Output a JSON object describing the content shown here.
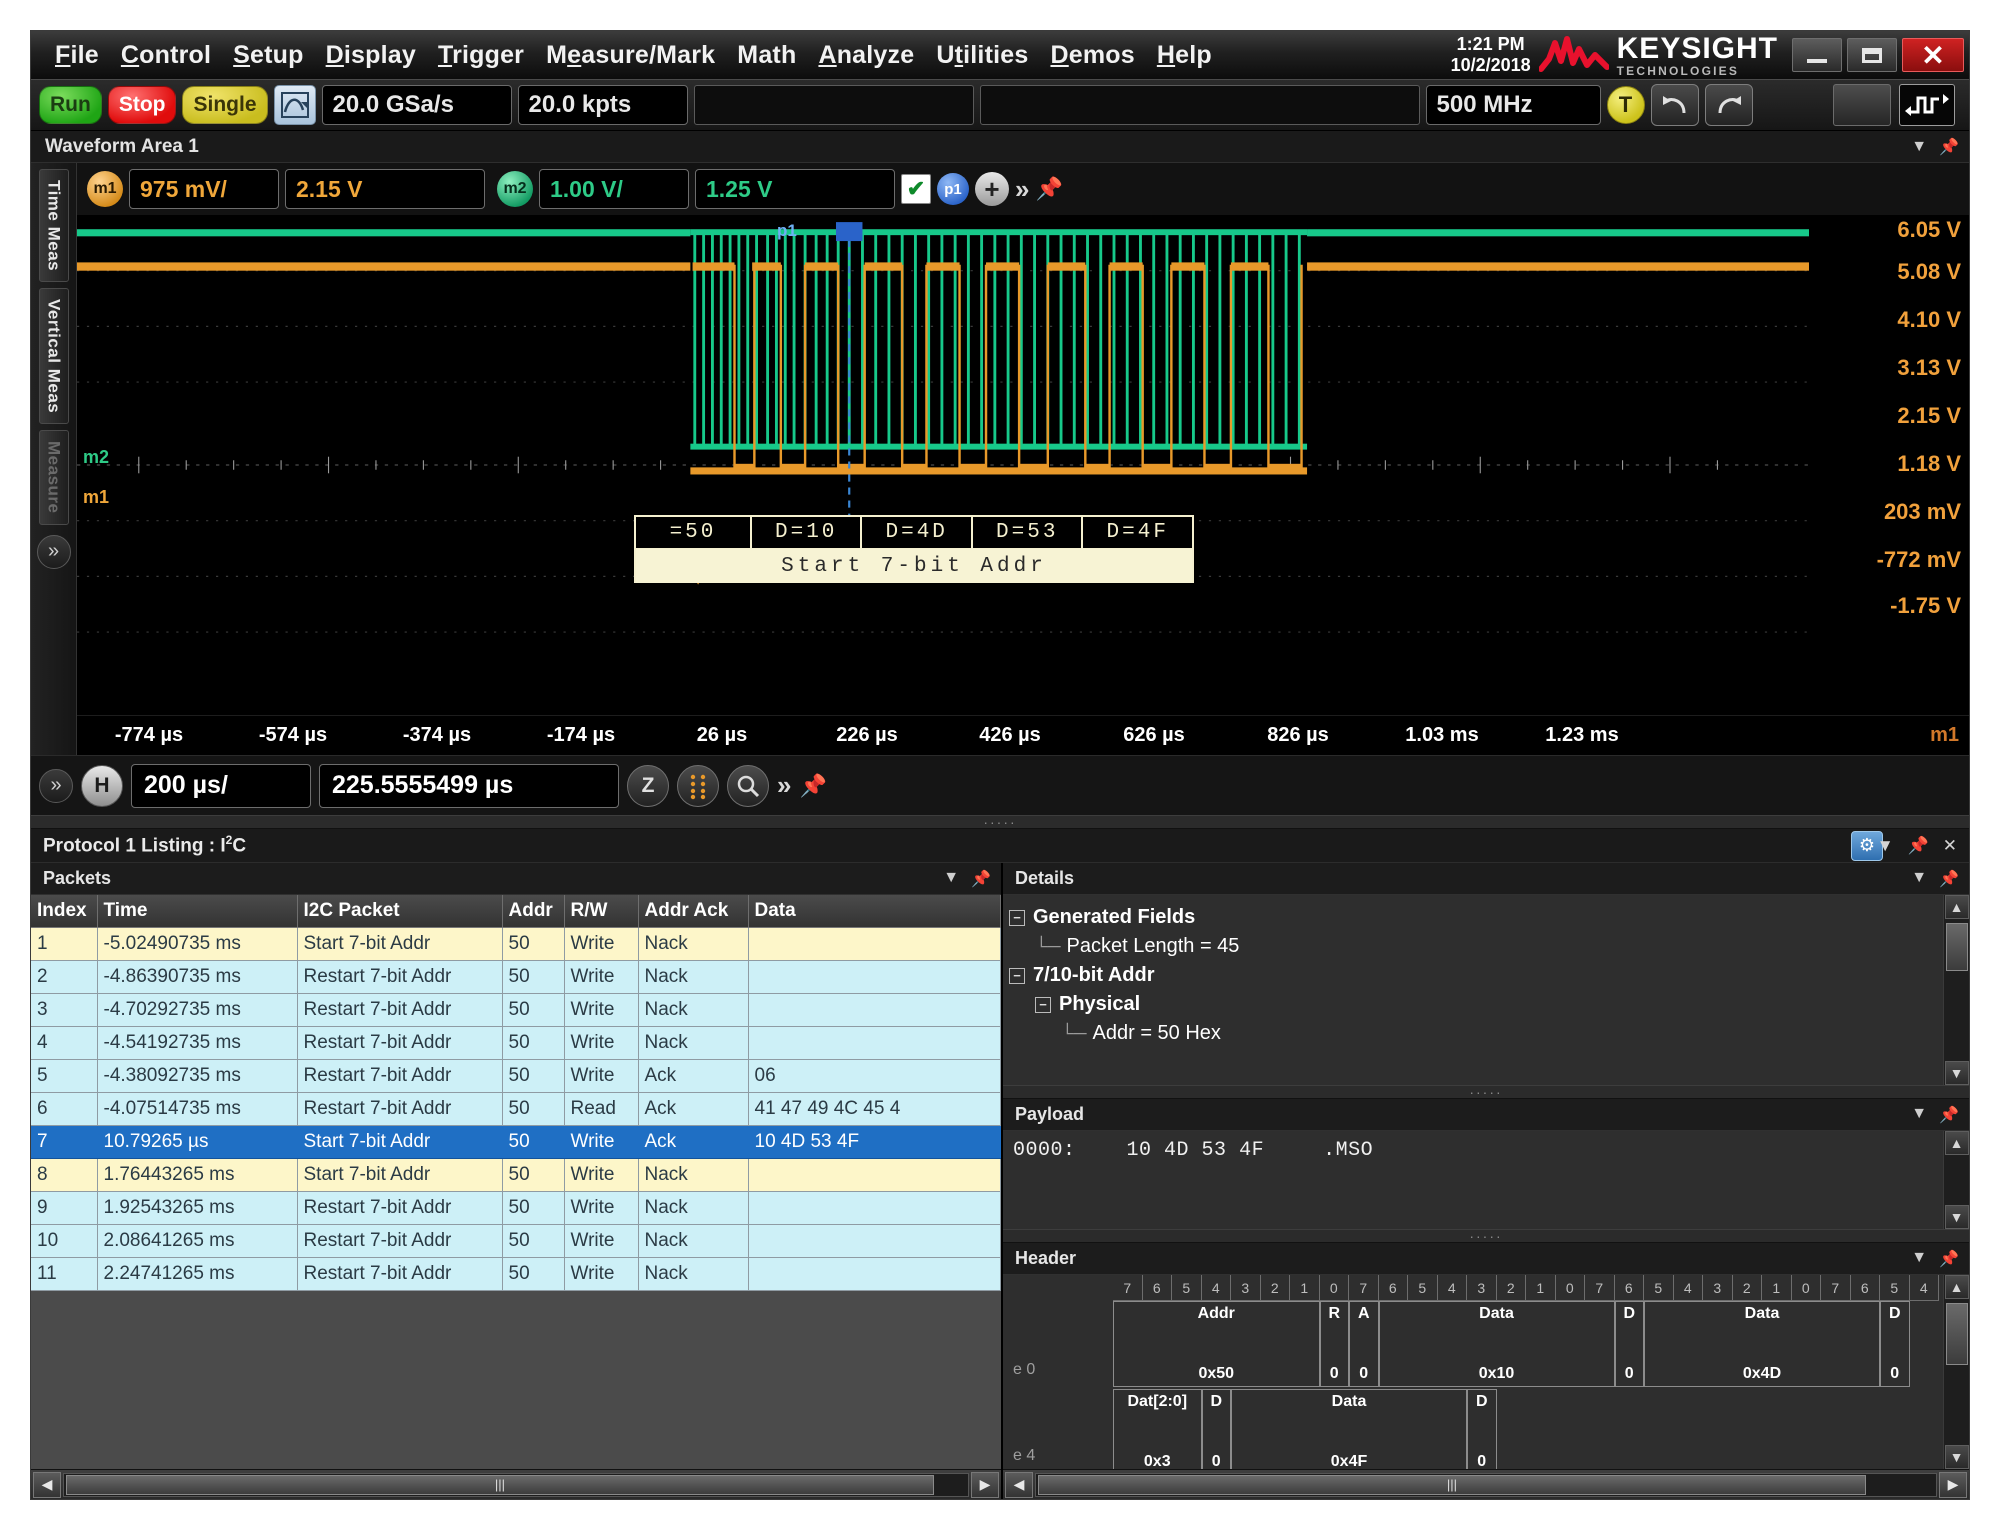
{
  "titlebar": {
    "menu": [
      "File",
      "Control",
      "Setup",
      "Display",
      "Trigger",
      "Measure/Mark",
      "Math",
      "Analyze",
      "Utilities",
      "Demos",
      "Help"
    ],
    "time": "1:21 PM",
    "date": "10/2/2018",
    "brand": "KEYSIGHT",
    "brand_sub": "TECHNOLOGIES",
    "minimize": "–",
    "maximize": "□",
    "close": "✕"
  },
  "toolbar": {
    "run": "Run",
    "stop": "Stop",
    "single": "Single",
    "sample_rate": "20.0 GSa/s",
    "memory": "20.0 kpts",
    "bandwidth": "500 MHz",
    "trigger_badge": "T",
    "undo": "↶",
    "redo": "↷"
  },
  "waveform_area": {
    "title": "Waveform Area 1",
    "rail_tabs": [
      "Time Meas",
      "Vertical Meas",
      "Measure"
    ],
    "channels": [
      {
        "id": "m1",
        "scale": "975 mV/",
        "offset": "2.15 V"
      },
      {
        "id": "m2",
        "scale": "1.00 V/",
        "offset": "1.25 V"
      }
    ],
    "probe_label": "p1",
    "marker_labels": [
      "m2",
      "m1"
    ],
    "trigger_marker": "p1",
    "volt_labels": [
      "6.05 V",
      "5.08 V",
      "4.10 V",
      "3.13 V",
      "2.15 V",
      "1.18 V",
      "203 mV",
      "-772 mV",
      "-1.75 V"
    ],
    "time_labels": [
      "-774 µs",
      "-574 µs",
      "-374 µs",
      "-174 µs",
      "26 µs",
      "226 µs",
      "426 µs",
      "626 µs",
      "826 µs",
      "1.03 ms",
      "1.23 ms"
    ],
    "time_axis_channel": "m1",
    "decode_cells": [
      "=50",
      "D=10",
      "D=4D",
      "D=53",
      "D=4F"
    ],
    "decode_caption": "Start 7-bit Addr",
    "timebase": {
      "h_badge": "H",
      "scale": "200 µs/",
      "position": "225.5555499 µs",
      "zoom_badge": "Z"
    }
  },
  "protocol": {
    "title": "Protocol 1 Listing : I",
    "title_sup": "2",
    "title_tail": "C",
    "packets_pane_title": "Packets",
    "columns": [
      "Index",
      "Time",
      "I2C Packet",
      "Addr",
      "R/W",
      "Addr Ack",
      "Data"
    ],
    "rows": [
      {
        "style": "row-yellow",
        "cells": [
          "1",
          "-5.02490735 ms",
          "Start 7-bit Addr",
          "50",
          "Write",
          "Nack",
          ""
        ]
      },
      {
        "style": "row-cyan",
        "cells": [
          "2",
          "-4.86390735 ms",
          "Restart 7-bit Addr",
          "50",
          "Write",
          "Nack",
          ""
        ]
      },
      {
        "style": "row-cyan",
        "cells": [
          "3",
          "-4.70292735 ms",
          "Restart 7-bit Addr",
          "50",
          "Write",
          "Nack",
          ""
        ]
      },
      {
        "style": "row-cyan",
        "cells": [
          "4",
          "-4.54192735 ms",
          "Restart 7-bit Addr",
          "50",
          "Write",
          "Nack",
          ""
        ]
      },
      {
        "style": "row-cyan",
        "cells": [
          "5",
          "-4.38092735 ms",
          "Restart 7-bit Addr",
          "50",
          "Write",
          "Ack",
          "06"
        ]
      },
      {
        "style": "row-cyan",
        "cells": [
          "6",
          "-4.07514735 ms",
          "Restart 7-bit Addr",
          "50",
          "Read",
          "Ack",
          "41 47 49 4C 45 4"
        ]
      },
      {
        "style": "row-sel",
        "cells": [
          "7",
          "10.79265 µs",
          "Start 7-bit Addr",
          "50",
          "Write",
          "Ack",
          "10 4D 53 4F"
        ]
      },
      {
        "style": "row-yellow",
        "cells": [
          "8",
          "1.76443265 ms",
          "Start 7-bit Addr",
          "50",
          "Write",
          "Nack",
          ""
        ]
      },
      {
        "style": "row-cyan",
        "cells": [
          "9",
          "1.92543265 ms",
          "Restart 7-bit Addr",
          "50",
          "Write",
          "Nack",
          ""
        ]
      },
      {
        "style": "row-cyan",
        "cells": [
          "10",
          "2.08641265 ms",
          "Restart 7-bit Addr",
          "50",
          "Write",
          "Nack",
          ""
        ]
      },
      {
        "style": "row-cyan",
        "cells": [
          "11",
          "2.24741265 ms",
          "Restart 7-bit Addr",
          "50",
          "Write",
          "Nack",
          ""
        ]
      }
    ]
  },
  "details": {
    "pane_title": "Details",
    "tree": [
      {
        "indent": 0,
        "expander": "−",
        "label": "Generated Fields",
        "bold": true
      },
      {
        "indent": 1,
        "expander": "",
        "label": "Packet Length = 45",
        "bold": false
      },
      {
        "indent": 0,
        "expander": "−",
        "label": "7/10-bit Addr",
        "bold": true
      },
      {
        "indent": 1,
        "expander": "−",
        "label": "Physical",
        "bold": true
      },
      {
        "indent": 2,
        "expander": "",
        "label": "Addr = 50 Hex",
        "bold": false
      }
    ]
  },
  "payload": {
    "pane_title": "Payload",
    "offset": "0000:",
    "bytes": "10 4D 53 4F",
    "ascii": ".MSO"
  },
  "header": {
    "pane_title": "Header",
    "bit_ruler": [
      "7",
      "6",
      "5",
      "4",
      "3",
      "2",
      "1",
      "0",
      "7",
      "6",
      "5",
      "4",
      "3",
      "2",
      "1",
      "0",
      "7",
      "6",
      "5",
      "4",
      "3",
      "2",
      "1",
      "0",
      "7",
      "6",
      "5",
      "4"
    ],
    "row_labels": [
      "e 0",
      "e 4"
    ],
    "row0_fields": [
      {
        "name": "Addr",
        "value": "0x50",
        "bits": 7
      },
      {
        "name": "R",
        "value": "0",
        "bits": 1
      },
      {
        "name": "A",
        "value": "0",
        "bits": 1
      },
      {
        "name": "Data",
        "value": "0x10",
        "bits": 8
      },
      {
        "name": "D",
        "value": "0",
        "bits": 1
      },
      {
        "name": "Data",
        "value": "0x4D",
        "bits": 8
      },
      {
        "name": "D",
        "value": "0",
        "bits": 1
      }
    ],
    "row1_fields": [
      {
        "name": "Dat[2:0]",
        "value": "0x3",
        "bits": 3
      },
      {
        "name": "D",
        "value": "0",
        "bits": 1
      },
      {
        "name": "Data",
        "value": "0x4F",
        "bits": 8
      },
      {
        "name": "D",
        "value": "0",
        "bits": 1
      }
    ]
  },
  "colors": {
    "channel1": "#f0a73a",
    "channel2": "#2ecb87",
    "selection": "#1f6fc4",
    "accent_red": "#cf2222"
  }
}
